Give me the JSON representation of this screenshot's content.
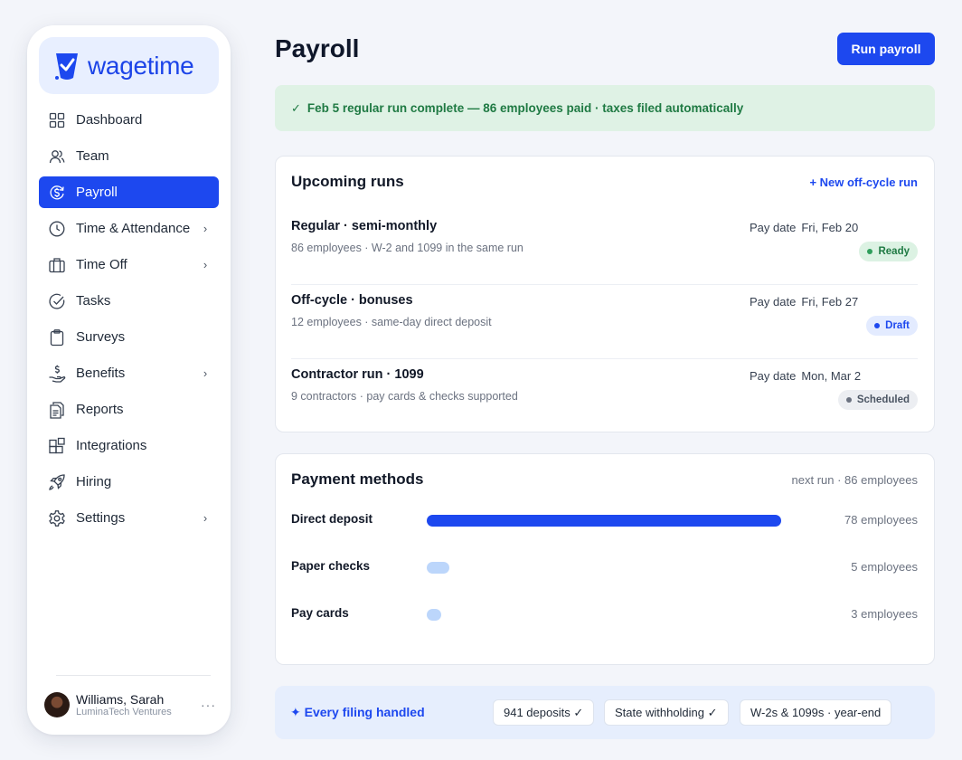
{
  "brand": {
    "name": "wagetime",
    "color": "#1d48ef"
  },
  "nav": [
    {
      "label": "Dashboard",
      "icon": "grid-icon",
      "chevron": false,
      "active": false
    },
    {
      "label": "Team",
      "icon": "users-icon",
      "chevron": false,
      "active": false
    },
    {
      "label": "Payroll",
      "icon": "dollar-refresh-icon",
      "chevron": false,
      "active": true
    },
    {
      "label": "Time & Attendance",
      "icon": "clock-icon",
      "chevron": true,
      "active": false
    },
    {
      "label": "Time Off",
      "icon": "suitcase-icon",
      "chevron": true,
      "active": false
    },
    {
      "label": "Tasks",
      "icon": "check-circle-icon",
      "chevron": false,
      "active": false
    },
    {
      "label": "Surveys",
      "icon": "clipboard-icon",
      "chevron": false,
      "active": false
    },
    {
      "label": "Benefits",
      "icon": "hand-dollar-icon",
      "chevron": true,
      "active": false
    },
    {
      "label": "Reports",
      "icon": "report-icon",
      "chevron": false,
      "active": false
    },
    {
      "label": "Integrations",
      "icon": "blocks-icon",
      "chevron": false,
      "active": false
    },
    {
      "label": "Hiring",
      "icon": "rocket-icon",
      "chevron": false,
      "active": false
    },
    {
      "label": "Settings",
      "icon": "gear-icon",
      "chevron": true,
      "active": false
    }
  ],
  "user": {
    "name": "Williams, Sarah",
    "org": "LuminaTech Ventures",
    "more": "···"
  },
  "header": {
    "title": "Payroll",
    "run_button": "Run payroll"
  },
  "banner": {
    "check": "✓",
    "text": "Feb 5 regular run complete — 86 employees paid · taxes filed automatically"
  },
  "upcoming": {
    "title": "Upcoming runs",
    "action": "+ New off-cycle run",
    "pay_date_label": "Pay date",
    "runs": [
      {
        "name": "Regular · semi-monthly",
        "desc": "86 employees · W-2 and 1099 in the same run",
        "date": "Fri, Feb 20",
        "status": "Ready"
      },
      {
        "name": "Off-cycle · bonuses",
        "desc": "12 employees · same-day direct deposit",
        "date": "Fri, Feb 27",
        "status": "Draft"
      },
      {
        "name": "Contractor run · 1099",
        "desc": "9 contractors · pay cards & checks supported",
        "date": "Mon, Mar 2",
        "status": "Scheduled"
      }
    ]
  },
  "payment_methods": {
    "title": "Payment methods",
    "meta": "next run · 86 employees",
    "max": 80,
    "methods": [
      {
        "label": "Direct deposit",
        "value": 78,
        "count": "78 employees"
      },
      {
        "label": "Paper checks",
        "value": 5,
        "count": "5 employees"
      },
      {
        "label": "Pay cards",
        "value": 3,
        "count": "3 employees"
      }
    ]
  },
  "filing": {
    "title": "✦ Every filing handled",
    "chips": [
      "941 deposits ✓",
      "State withholding ✓",
      "W-2s & 1099s · year-end"
    ]
  }
}
